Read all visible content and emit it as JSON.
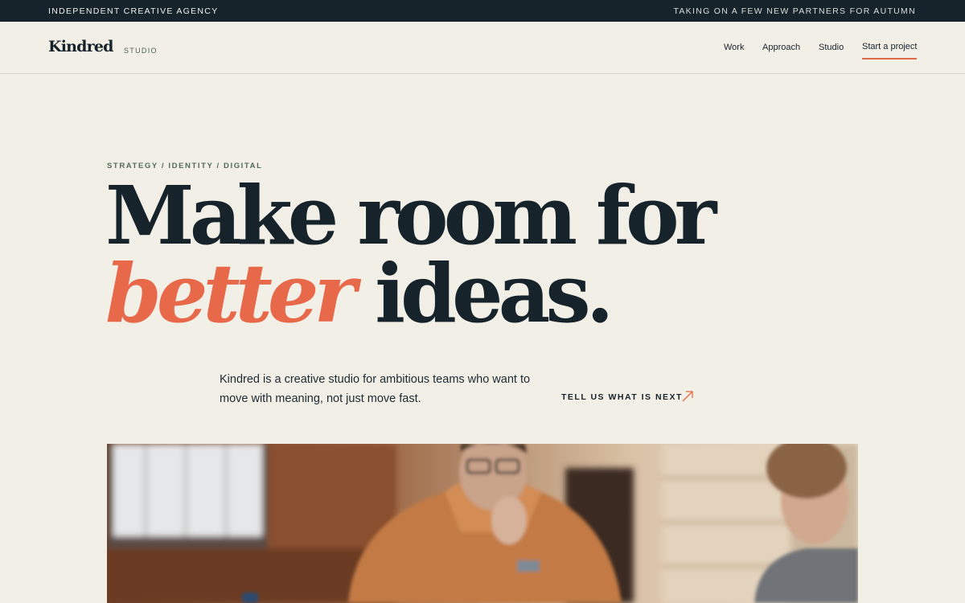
{
  "topbar": {
    "left_text": "INDEPENDENT CREATIVE AGENCY",
    "right_text": "TAKING ON A FEW NEW PARTNERS FOR AUTUMN"
  },
  "header": {
    "logo": "Kindred",
    "logo_sub": "STUDIO",
    "nav": {
      "work": "Work",
      "approach": "Approach",
      "studio": "Studio",
      "cta": "Start a project"
    }
  },
  "hero": {
    "eyebrow": "STRATEGY / IDENTITY / DIGITAL",
    "line1": "Make room for",
    "line2_accent": "better",
    "line2_rest": " ideas.",
    "intro": "Kindred is a creative studio for ambitious teams who want to move with meaning, not just move fast.",
    "cta": "TELL US WHAT IS NEXT"
  },
  "colors": {
    "background": "#f2efe7",
    "topbar": "#17232b",
    "ink": "#16232b",
    "accent": "#e8694a"
  },
  "icons": {
    "cta_arrow": "arrow-up-right-icon"
  }
}
